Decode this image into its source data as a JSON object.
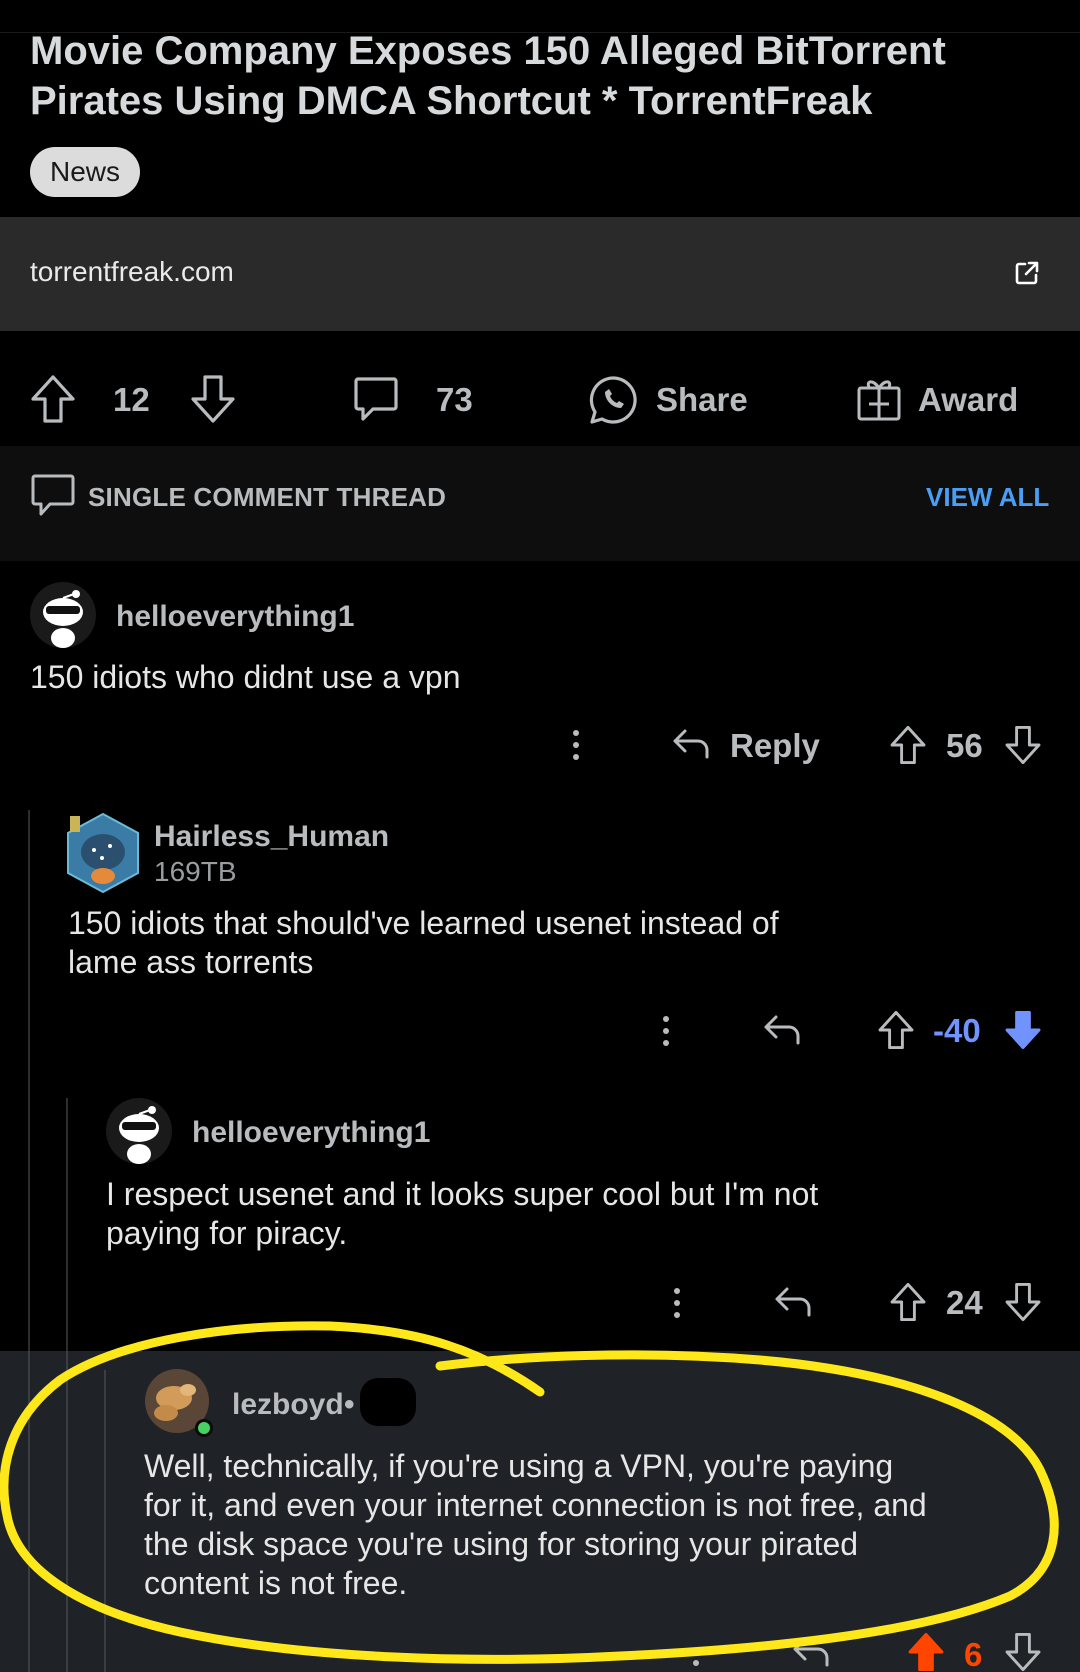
{
  "post": {
    "title": "Movie Company Exposes 150 Alleged BitTorrent Pirates Using DMCA Shortcut * TorrentFreak",
    "flair": "News",
    "link_domain": "torrentfreak.com",
    "upvotes": "12",
    "comments": "73",
    "share_label": "Share",
    "award_label": "Award"
  },
  "thread": {
    "mode_label": "SINGLE COMMENT THREAD",
    "view_all_label": "VIEW ALL"
  },
  "comments": [
    {
      "username": "helloeverything1",
      "text": "150 idiots who didnt use a vpn",
      "reply_label": "Reply",
      "score": "56"
    },
    {
      "username": "Hairless_Human",
      "flair": "169TB",
      "text_line1": "150 idiots that should've learned usenet instead of",
      "text_line2": "lame ass torrents",
      "score": "-40"
    },
    {
      "username": "helloeverything1",
      "text_line1": "I respect usenet and it looks super cool but I'm not",
      "text_line2": "paying for piracy.",
      "score": "24"
    },
    {
      "username": "lezboyd",
      "separator": "•",
      "text_line1": "Well, technically, if you're using a VPN, you're paying",
      "text_line2": "for it, and even your internet connection is not free, and",
      "text_line3": "the disk space you're using for storing your pirated",
      "text_line4": "content is not free.",
      "score": "6"
    }
  ],
  "colors": {
    "background": "#000000",
    "link_bar": "#2a2a2b",
    "accent_blue": "#4a9ff5",
    "downvote_blue": "#7193ff",
    "upvote_orange": "#ff4500",
    "highlight_yellow": "#ffe81a",
    "online_green": "#46d160"
  },
  "icons": [
    "upvote-icon",
    "downvote-icon",
    "comment-icon",
    "whatsapp-share-icon",
    "gift-award-icon",
    "external-link-icon",
    "reply-arrow-icon",
    "more-options-icon",
    "snoo-avatar-icon"
  ]
}
